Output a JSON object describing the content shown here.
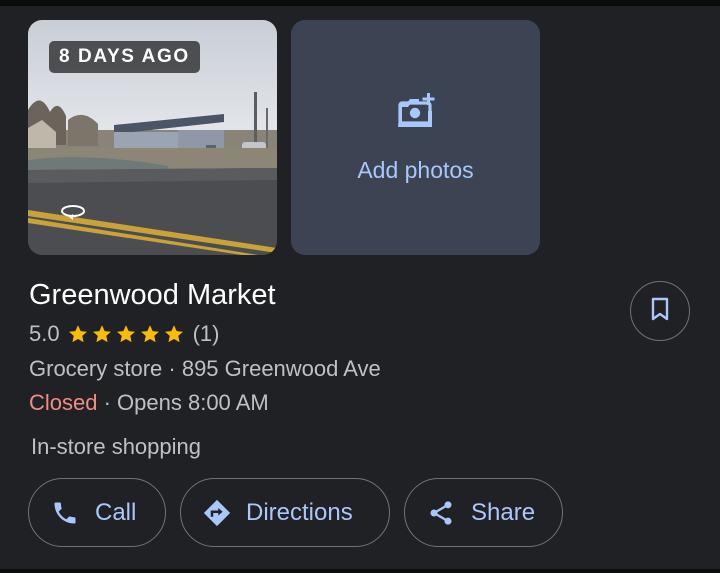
{
  "photo": {
    "age_label": "8 DAYS AGO"
  },
  "add_photos": {
    "label": "Add photos"
  },
  "place": {
    "name": "Greenwood Market",
    "rating": "5.0",
    "stars": 5,
    "review_count": "(1)",
    "category": "Grocery store",
    "separator": " · ",
    "address": "895 Greenwood Ave",
    "status": "Closed",
    "opens": "Opens 8:00 AM",
    "service": "In-store shopping"
  },
  "actions": {
    "call": "Call",
    "directions": "Directions",
    "share": "Share"
  },
  "icons": {
    "save": "bookmark-icon",
    "call": "phone-icon",
    "directions": "directions-icon",
    "share": "share-icon",
    "add_photo": "add-photo-camera-icon",
    "panorama": "360-rotate-icon"
  },
  "colors": {
    "background": "#202124",
    "accent": "#a8c7fa",
    "closed": "#f28b82",
    "star": "#fbbc04",
    "muted_text": "#bdc1c6"
  }
}
